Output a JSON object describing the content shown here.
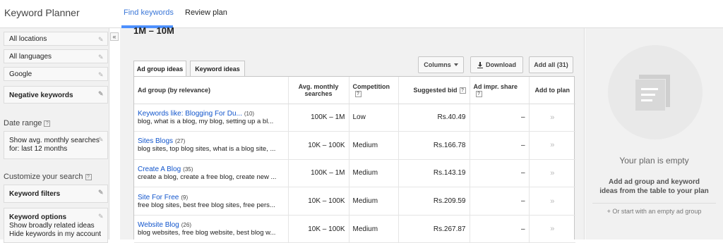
{
  "app": {
    "title": "Keyword Planner"
  },
  "tabs": [
    {
      "label": "Find keywords"
    },
    {
      "label": "Review plan"
    }
  ],
  "sidebar": {
    "locations": "All locations",
    "languages": "All languages",
    "network": "Google",
    "negative_keywords": "Negative keywords",
    "date_range_heading": "Date range",
    "date_range_value": "Show avg. monthly searches for: last 12 months",
    "customize_heading": "Customize your search",
    "keyword_filters": "Keyword filters",
    "keyword_options": "Keyword options",
    "keyword_options_line1": "Show broadly related ideas",
    "keyword_options_line2": "Hide keywords in my account",
    "collapse_glyph": "«",
    "help_glyph": "?"
  },
  "main": {
    "range_title": "1M – 10M",
    "subtabs": [
      {
        "label": "Ad group ideas"
      },
      {
        "label": "Keyword ideas"
      }
    ],
    "columns_button": "Columns",
    "download_button": "Download",
    "add_all_button": "Add all (31)"
  },
  "table": {
    "headers": {
      "ad_group": "Ad group (by relevance)",
      "searches": "Avg. monthly searches",
      "competition": "Competition",
      "bid": "Suggested bid",
      "share": "Ad impr. share",
      "add": "Add to plan"
    },
    "rows": [
      {
        "name": "Keywords like: Blogging For Du...",
        "count": "(10)",
        "keywords": "blog, what is a blog, my blog, setting up a bl...",
        "searches": "100K – 1M",
        "competition": "Low",
        "bid": "Rs.40.49",
        "share": "–",
        "add": "»"
      },
      {
        "name": "Sites Blogs",
        "count": "(27)",
        "keywords": "blog sites, top blog sites, what is a blog site, ...",
        "searches": "10K – 100K",
        "competition": "Medium",
        "bid": "Rs.166.78",
        "share": "–",
        "add": "»"
      },
      {
        "name": "Create A Blog",
        "count": "(35)",
        "keywords": "create a blog, create a free blog, create new ...",
        "searches": "100K – 1M",
        "competition": "Medium",
        "bid": "Rs.143.19",
        "share": "–",
        "add": "»"
      },
      {
        "name": "Site For Free",
        "count": "(9)",
        "keywords": "free blog sites, best free blog sites, free pers...",
        "searches": "10K – 100K",
        "competition": "Medium",
        "bid": "Rs.209.59",
        "share": "–",
        "add": "»"
      },
      {
        "name": "Website Blog",
        "count": "(26)",
        "keywords": "blog websites, free blog website, best blog w...",
        "searches": "10K – 100K",
        "competition": "Medium",
        "bid": "Rs.267.87",
        "share": "–",
        "add": "»"
      }
    ]
  },
  "plan": {
    "empty_title": "Your plan is empty",
    "description": "Add ad group and keyword ideas from the table to your plan",
    "start_link": "+ Or start with an empty ad group"
  }
}
